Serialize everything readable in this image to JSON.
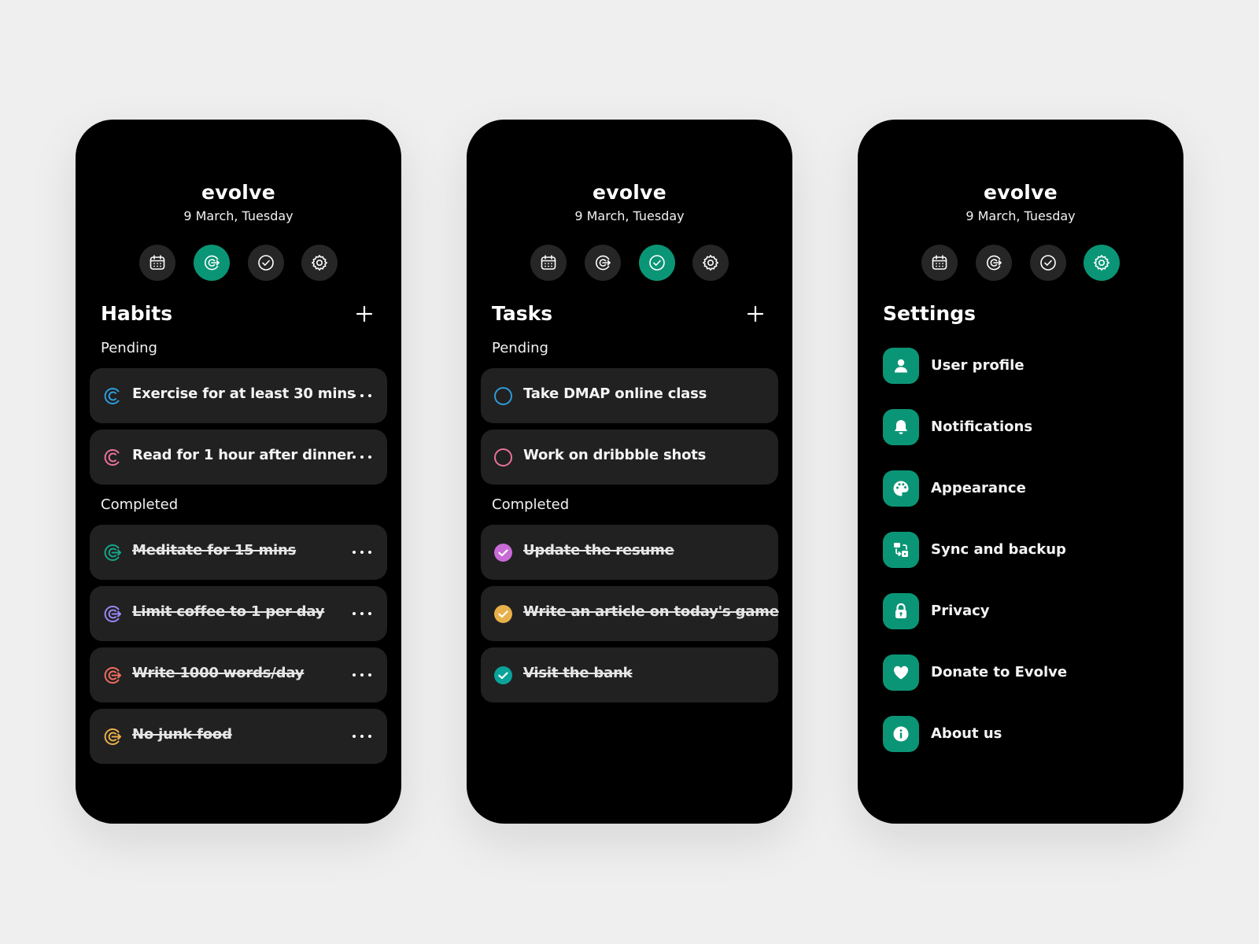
{
  "app": {
    "title": "evolve",
    "date": "9 March, Tuesday"
  },
  "nav_icons": [
    "calendar-icon",
    "habit-target-icon",
    "check-circle-icon",
    "gear-icon"
  ],
  "colors": {
    "accent": "#0a9676",
    "card": "#212121",
    "phone": "#000000",
    "background": "#efefef"
  },
  "habits": {
    "title": "Habits",
    "active_tab": 1,
    "pending_label": "Pending",
    "completed_label": "Completed",
    "pending": [
      {
        "label": "Exercise for at least 30 mins",
        "color": "#2d9cdb"
      },
      {
        "label": "Read for 1 hour after dinner",
        "color": "#e8729a"
      }
    ],
    "completed": [
      {
        "label": "Meditate for 15 mins",
        "color": "#17a589"
      },
      {
        "label": "Limit coffee to 1 per day",
        "color": "#9b87f5"
      },
      {
        "label": "Write 1000 words/day",
        "color": "#ee6e5e"
      },
      {
        "label": "No junk food",
        "color": "#e8b04a"
      }
    ]
  },
  "tasks": {
    "title": "Tasks",
    "active_tab": 2,
    "pending_label": "Pending",
    "completed_label": "Completed",
    "pending": [
      {
        "label": "Take DMAP online class",
        "color": "#2d9cdb"
      },
      {
        "label": "Work on dribbble shots",
        "color": "#e8729a"
      }
    ],
    "completed": [
      {
        "label": "Update the resume",
        "color": "#c86bd6"
      },
      {
        "label": "Write an article on today's game",
        "color": "#e8b04a"
      },
      {
        "label": "Visit the bank",
        "color": "#0aa39a"
      }
    ]
  },
  "settings": {
    "title": "Settings",
    "active_tab": 3,
    "items": [
      {
        "label": "User profile",
        "icon": "user-icon"
      },
      {
        "label": "Notifications",
        "icon": "bell-icon"
      },
      {
        "label": "Appearance",
        "icon": "palette-icon"
      },
      {
        "label": "Sync and backup",
        "icon": "sync-icon"
      },
      {
        "label": "Privacy",
        "icon": "lock-icon"
      },
      {
        "label": "Donate to Evolve",
        "icon": "heart-icon"
      },
      {
        "label": "About us",
        "icon": "info-icon"
      }
    ]
  }
}
